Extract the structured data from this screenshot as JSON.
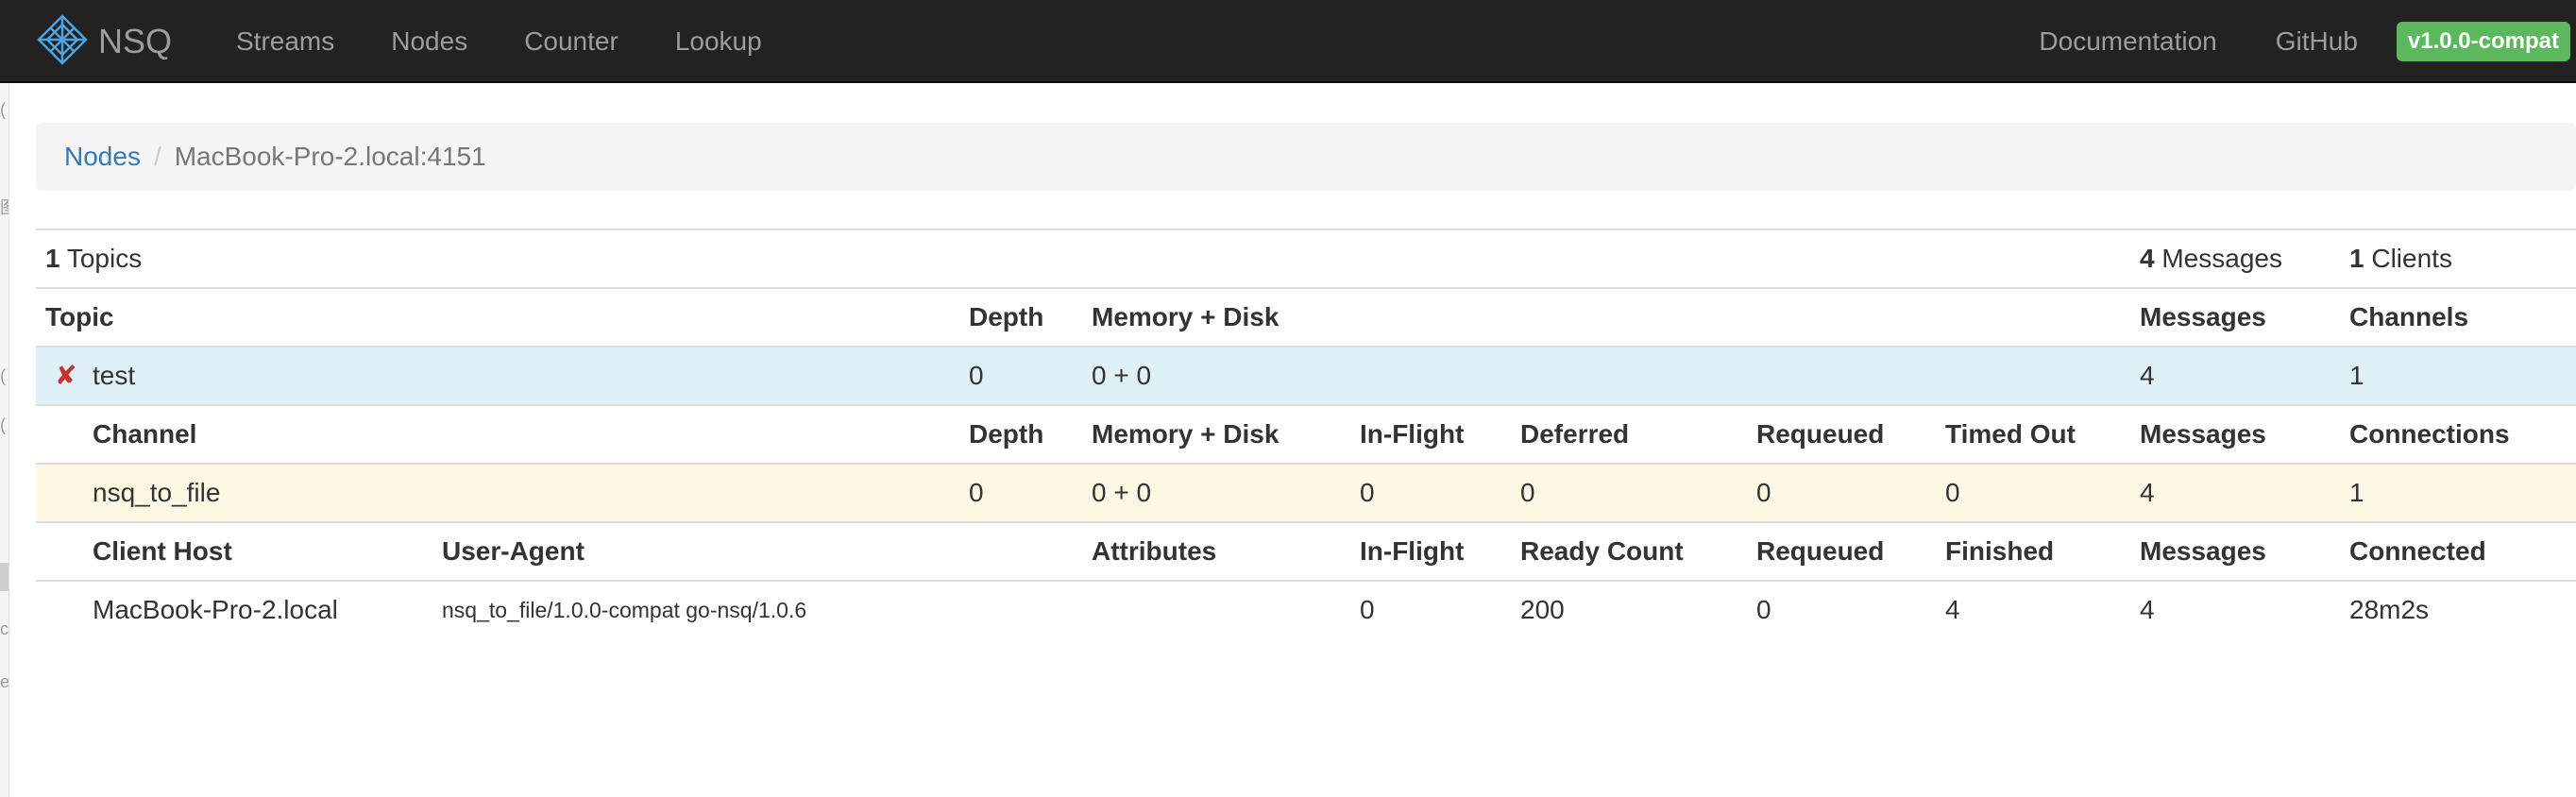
{
  "navbar": {
    "brand": "NSQ",
    "links": [
      "Streams",
      "Nodes",
      "Counter",
      "Lookup"
    ],
    "right_links": [
      "Documentation",
      "GitHub"
    ],
    "version": "v1.0.0-compat",
    "accent_color": "#5cb85c"
  },
  "breadcrumb": {
    "parent": "Nodes",
    "current": "MacBook-Pro-2.local:4151"
  },
  "summary": {
    "topics_count": "1",
    "topics_label": " Topics",
    "messages_count": "4",
    "messages_label": " Messages",
    "clients_count": "1",
    "clients_label": " Clients"
  },
  "topic_header": {
    "topic": "Topic",
    "depth": "Depth",
    "memory_disk": "Memory + Disk",
    "messages": "Messages",
    "channels": "Channels"
  },
  "topic": {
    "delete_icon": "✘",
    "name": "test",
    "depth": "0",
    "memory_disk": "0 + 0",
    "messages": "4",
    "channels": "1"
  },
  "channel_header": {
    "channel": "Channel",
    "depth": "Depth",
    "memory_disk": "Memory + Disk",
    "in_flight": "In-Flight",
    "deferred": "Deferred",
    "requeued": "Requeued",
    "timed_out": "Timed Out",
    "messages": "Messages",
    "connections": "Connections"
  },
  "channel": {
    "name": "nsq_to_file",
    "depth": "0",
    "memory_disk": "0 + 0",
    "in_flight": "0",
    "deferred": "0",
    "requeued": "0",
    "timed_out": "0",
    "messages": "4",
    "connections": "1"
  },
  "client_header": {
    "client_host": "Client Host",
    "user_agent": "User-Agent",
    "attributes": "Attributes",
    "in_flight": "In-Flight",
    "ready_count": "Ready Count",
    "requeued": "Requeued",
    "finished": "Finished",
    "messages": "Messages",
    "connected": "Connected"
  },
  "client": {
    "host": "MacBook-Pro-2.local",
    "user_agent": "nsq_to_file/1.0.0-compat go-nsq/1.0.6",
    "attributes": "",
    "in_flight": "0",
    "ready_count": "200",
    "requeued": "0",
    "finished": "4",
    "messages": "4",
    "connected": "28m2s"
  }
}
